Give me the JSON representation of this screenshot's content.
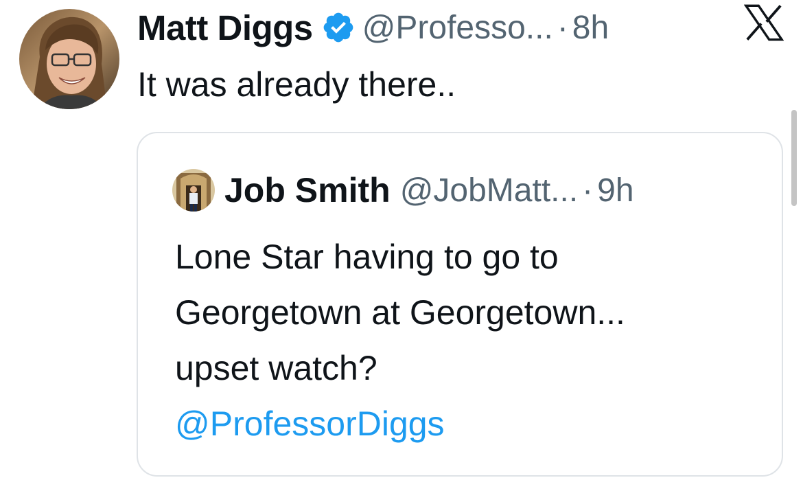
{
  "tweet": {
    "author_name": "Matt Diggs",
    "handle": "@Professo...",
    "separator": "·",
    "time": "8h",
    "text": "It was already there.."
  },
  "quoted": {
    "author_name": "Job Smith",
    "handle": "@JobMatt...",
    "separator": "·",
    "time": "9h",
    "lines": [
      "Lone Star having to go to",
      "Georgetown at Georgetown...",
      "upset watch?"
    ],
    "mention": "@ProfessorDiggs"
  },
  "icons": {
    "verified": "verified-badge-icon",
    "platform": "x-logo-icon"
  },
  "colors": {
    "text": "#0f1419",
    "secondary": "#536471",
    "accent": "#1d9bf0",
    "border": "#dfe3e7"
  }
}
